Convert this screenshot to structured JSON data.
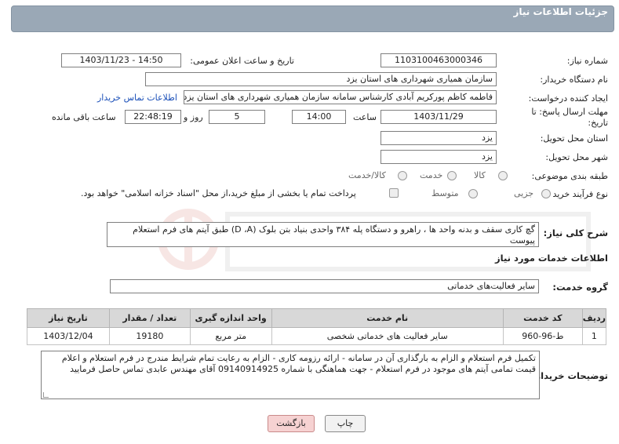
{
  "header": {
    "title": "جزئیات اطلاعات نیاز"
  },
  "fields": {
    "need_number_label": "شماره نیاز:",
    "need_number": "1103100463000346",
    "announce_label": "تاریخ و ساعت اعلان عمومی:",
    "announce_value": "1403/11/23 - 14:50",
    "buyer_org_label": "نام دستگاه خریدار:",
    "buyer_org": "سازمان همیاری شهرداری های استان یزد",
    "creator_label": "ایجاد کننده درخواست:",
    "creator": "فاطمه کاظم پورکریم آبادی کارشناس سامانه سازمان همیاری شهرداری های استان یزد",
    "contact_link": "اطلاعات تماس خریدار",
    "deadline_label": "مهلت ارسال پاسخ: تا تاریخ:",
    "deadline_date": "1403/11/29",
    "time_label": "ساعت",
    "deadline_time": "14:00",
    "days_value": "5",
    "days_label": "روز و",
    "remaining_time": "22:48:19",
    "remaining_label": "ساعت باقی مانده",
    "province_label": "استان محل تحویل:",
    "province": "یزد",
    "city_label": "شهر محل تحویل:",
    "city": "یزد",
    "category_label": "طبقه بندی موضوعی:",
    "category_options": [
      "کالا",
      "خدمت",
      "کالا/خدمت"
    ],
    "process_label": "نوع فرآیند خرید :",
    "process_options": [
      "جزیی",
      "متوسط"
    ],
    "payment_note": "پرداخت تمام یا بخشی از مبلغ خرید،از محل \"اسناد خزانه اسلامی\" خواهد بود."
  },
  "summary": {
    "label": "شرح کلی نیاز:",
    "text": "گچ کاری سقف و بدنه واحد ها ، راهرو و دستگاه پله ۳۸۴ واحدی بنیاد بتن بلوک (D ،A) طبق آیتم های فرم استعلام پیوست"
  },
  "services_title": "اطلاعات خدمات مورد نیاز",
  "service_group": {
    "label": "گروه خدمت:",
    "value": "سایر فعالیت‌های خدماتی"
  },
  "table": {
    "headers": [
      "ردیف",
      "کد خدمت",
      "نام خدمت",
      "واحد اندازه گیری",
      "تعداد / مقدار",
      "تاریخ نیاز"
    ],
    "rows": [
      [
        "1",
        "ط-96-960",
        "سایر فعالیت های خدماتی شخصی",
        "متر مربع",
        "19180",
        "1403/12/04"
      ]
    ]
  },
  "buyer_notes": {
    "label": "توضیحات خریدار:",
    "text": "تکمیل فرم استعلام و الزام به بارگذاری آن در سامانه - ارائه رزومه کاری - الزام به رعایت تمام شرایط مندرج در فرم استعلام و اعلام قیمت تمامی آیتم های موجود در فرم استعلام - جهت هماهنگی با شماره 09140914925 آقای مهندس عابدی تماس حاصل فرمایید"
  },
  "buttons": {
    "print": "چاپ",
    "back": "بازگشت"
  },
  "colors": {
    "header_bg": "#9aa8b6",
    "link": "#1a4fb8",
    "back_button": "#f6d2d2"
  }
}
